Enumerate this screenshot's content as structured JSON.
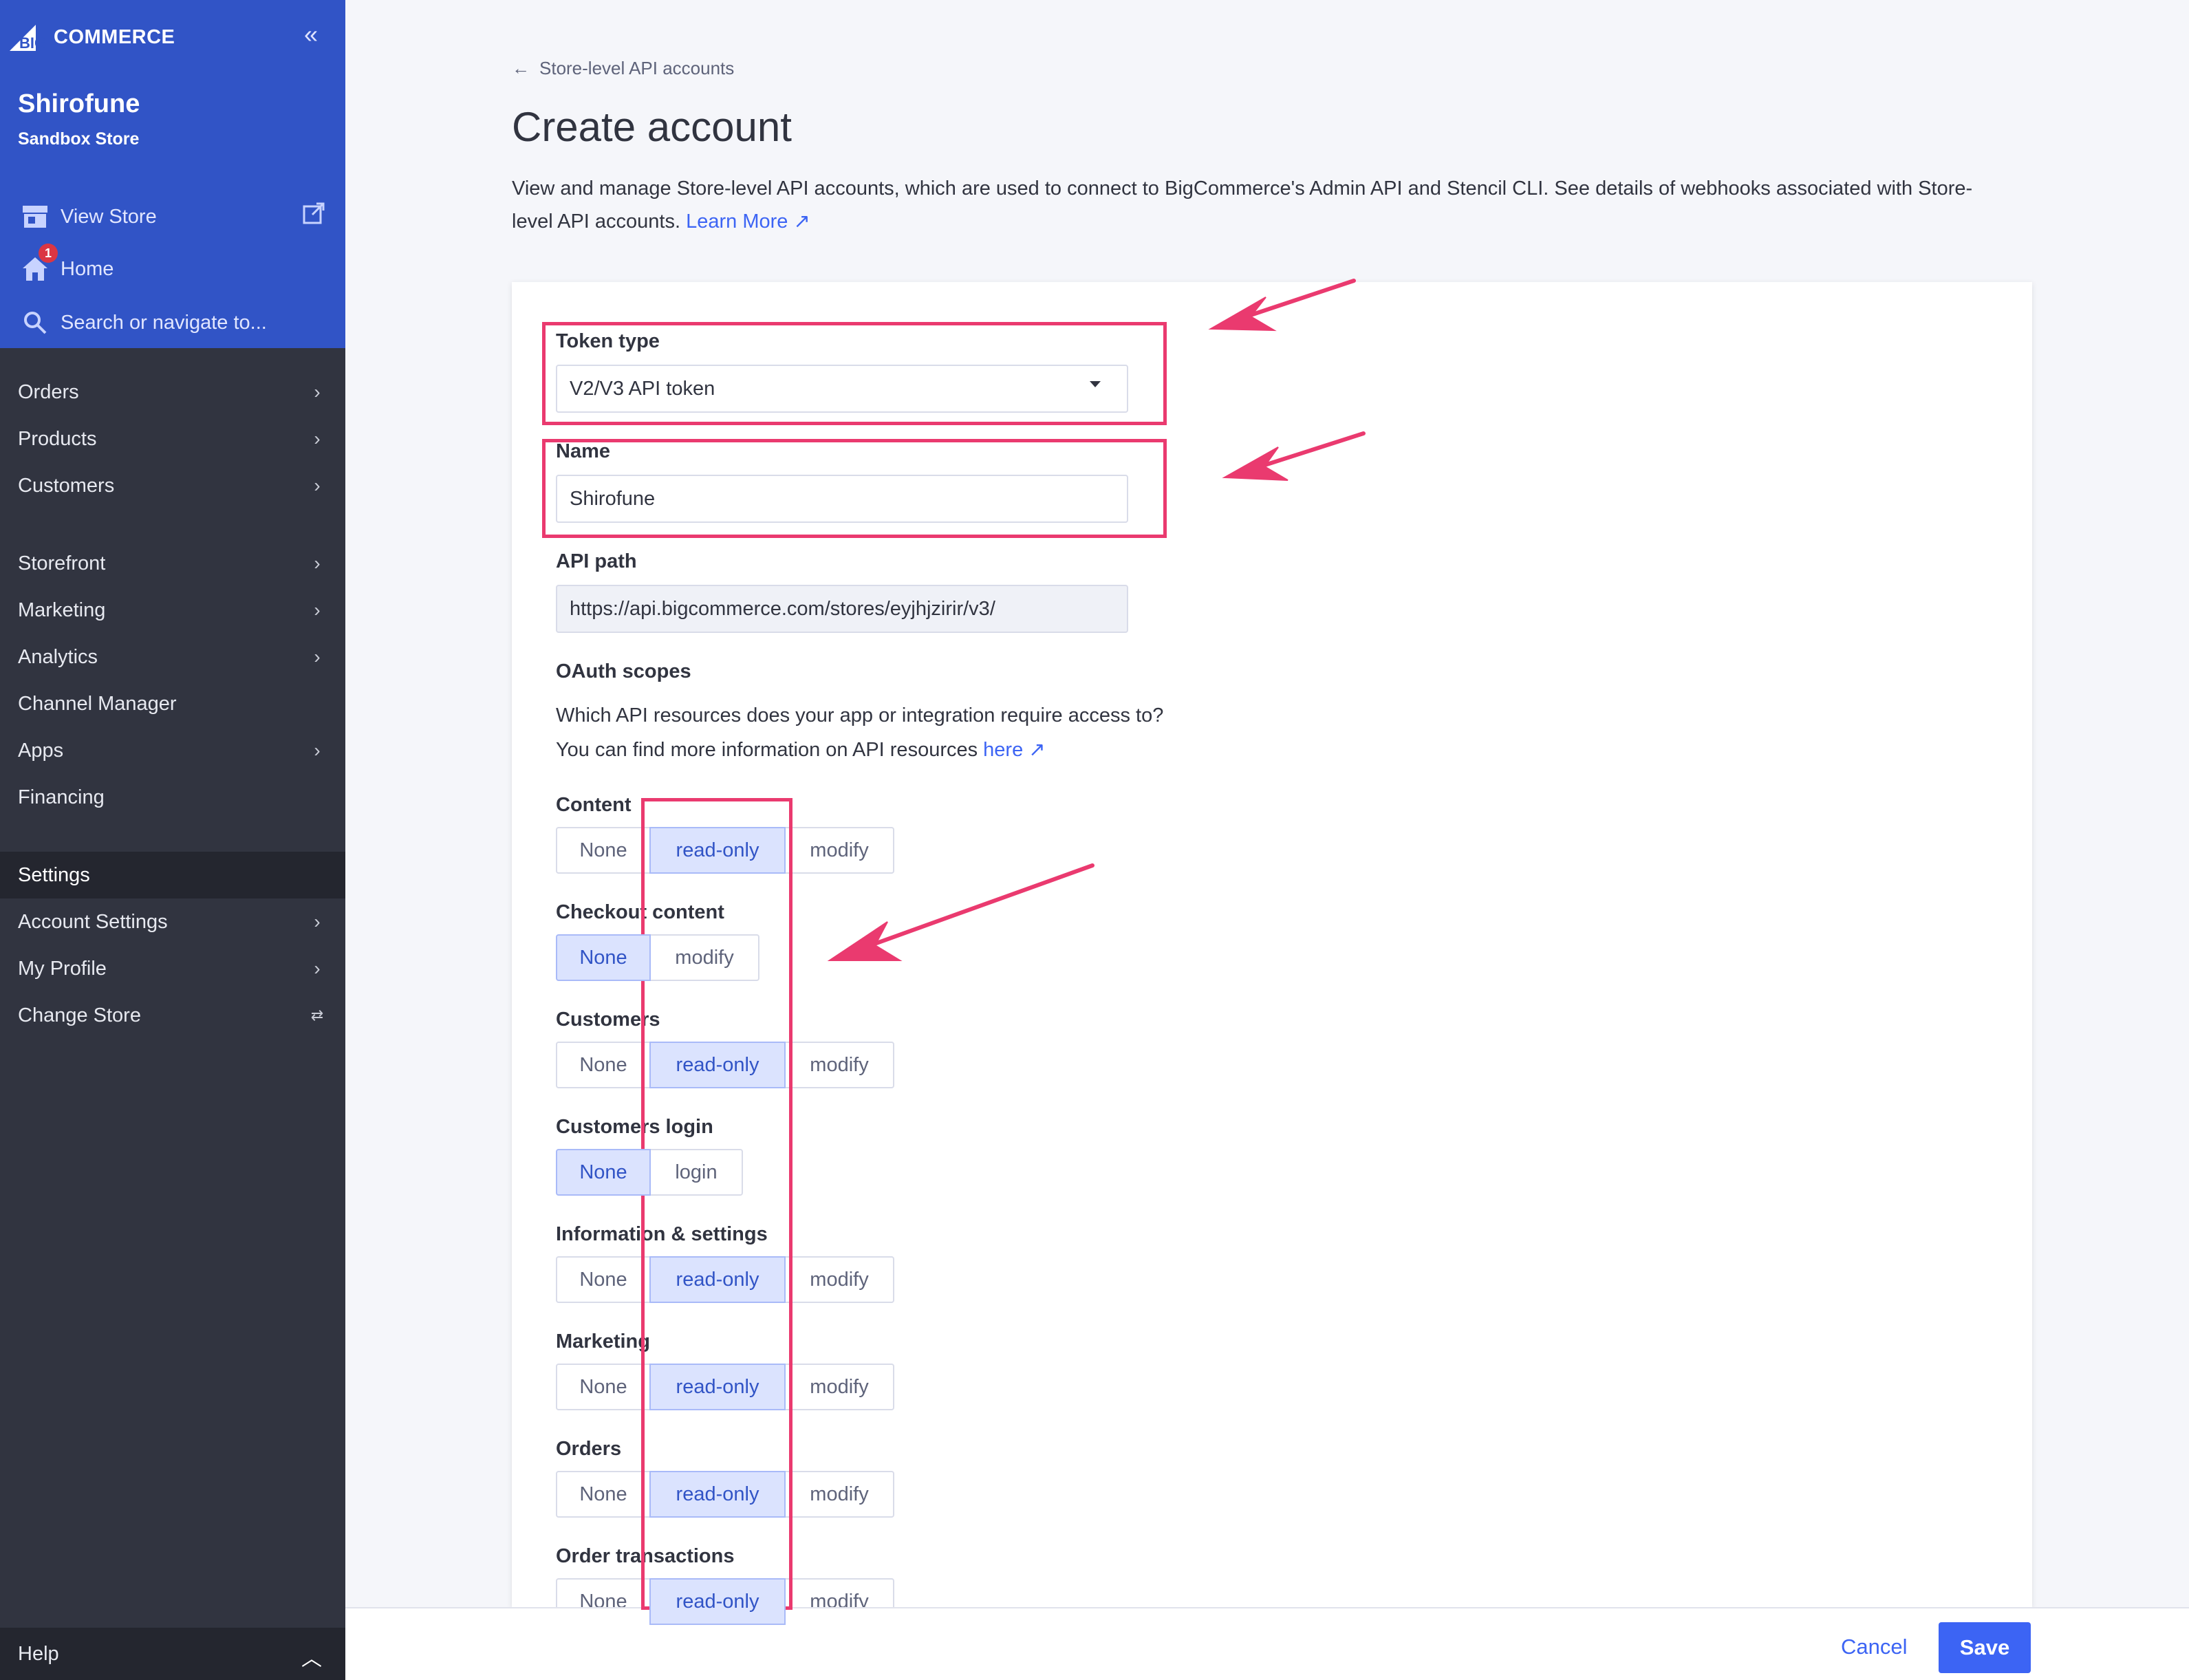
{
  "brand": {
    "logo_text": "COMMERCE",
    "logo_prefix": "BIG"
  },
  "store": {
    "name": "Shirofune",
    "subtitle": "Sandbox Store"
  },
  "quick_links": {
    "view_store": "View Store",
    "home": "Home",
    "home_badge": "1",
    "search": "Search or navigate to..."
  },
  "nav": {
    "items": [
      {
        "label": "Orders"
      },
      {
        "label": "Products"
      },
      {
        "label": "Customers"
      },
      {
        "label": "Storefront"
      },
      {
        "label": "Marketing"
      },
      {
        "label": "Analytics"
      },
      {
        "label": "Channel Manager"
      },
      {
        "label": "Apps"
      },
      {
        "label": "Financing"
      }
    ],
    "settings_header": "Settings",
    "settings_items": [
      {
        "label": "Account Settings"
      },
      {
        "label": "My Profile"
      },
      {
        "label": "Change Store"
      }
    ],
    "help": "Help"
  },
  "page": {
    "breadcrumb": "Store-level API accounts",
    "title": "Create account",
    "description_1": "View and manage Store-level API accounts, which are used to connect to BigCommerce's Admin API and Stencil CLI. See details of webhooks associated with Store-",
    "description_2": "level API accounts.",
    "learn_more": "Learn More"
  },
  "form": {
    "token_type_label": "Token type",
    "token_type_value": "V2/V3 API token",
    "name_label": "Name",
    "name_value": "Shirofune",
    "api_path_label": "API path",
    "api_path_value": "https://api.bigcommerce.com/stores/eyjhjzirir/v3/",
    "oauth_label": "OAuth scopes",
    "oauth_help_1": "Which API resources does your app or integration require access to?",
    "oauth_help_2": "You can find more information on API resources",
    "oauth_help_link": "here",
    "scopes": [
      {
        "label": "Content",
        "options": [
          "None",
          "read-only",
          "modify"
        ],
        "selected": "read-only"
      },
      {
        "label": "Checkout content",
        "options": [
          "None",
          "modify"
        ],
        "selected": "None"
      },
      {
        "label": "Customers",
        "options": [
          "None",
          "read-only",
          "modify"
        ],
        "selected": "read-only"
      },
      {
        "label": "Customers login",
        "options": [
          "None",
          "login"
        ],
        "selected": "None"
      },
      {
        "label": "Information & settings",
        "options": [
          "None",
          "read-only",
          "modify"
        ],
        "selected": "read-only"
      },
      {
        "label": "Marketing",
        "options": [
          "None",
          "read-only",
          "modify"
        ],
        "selected": "read-only"
      },
      {
        "label": "Orders",
        "options": [
          "None",
          "read-only",
          "modify"
        ],
        "selected": "read-only"
      },
      {
        "label": "Order transactions",
        "options": [
          "None",
          "read-only",
          "modify"
        ],
        "selected": "read-only"
      }
    ]
  },
  "footer": {
    "cancel": "Cancel",
    "save": "Save"
  },
  "colors": {
    "sidebar": "#313440",
    "sidebar_top": "#3154c6",
    "accent": "#3c64f4",
    "highlight": "#ea3a6f"
  }
}
